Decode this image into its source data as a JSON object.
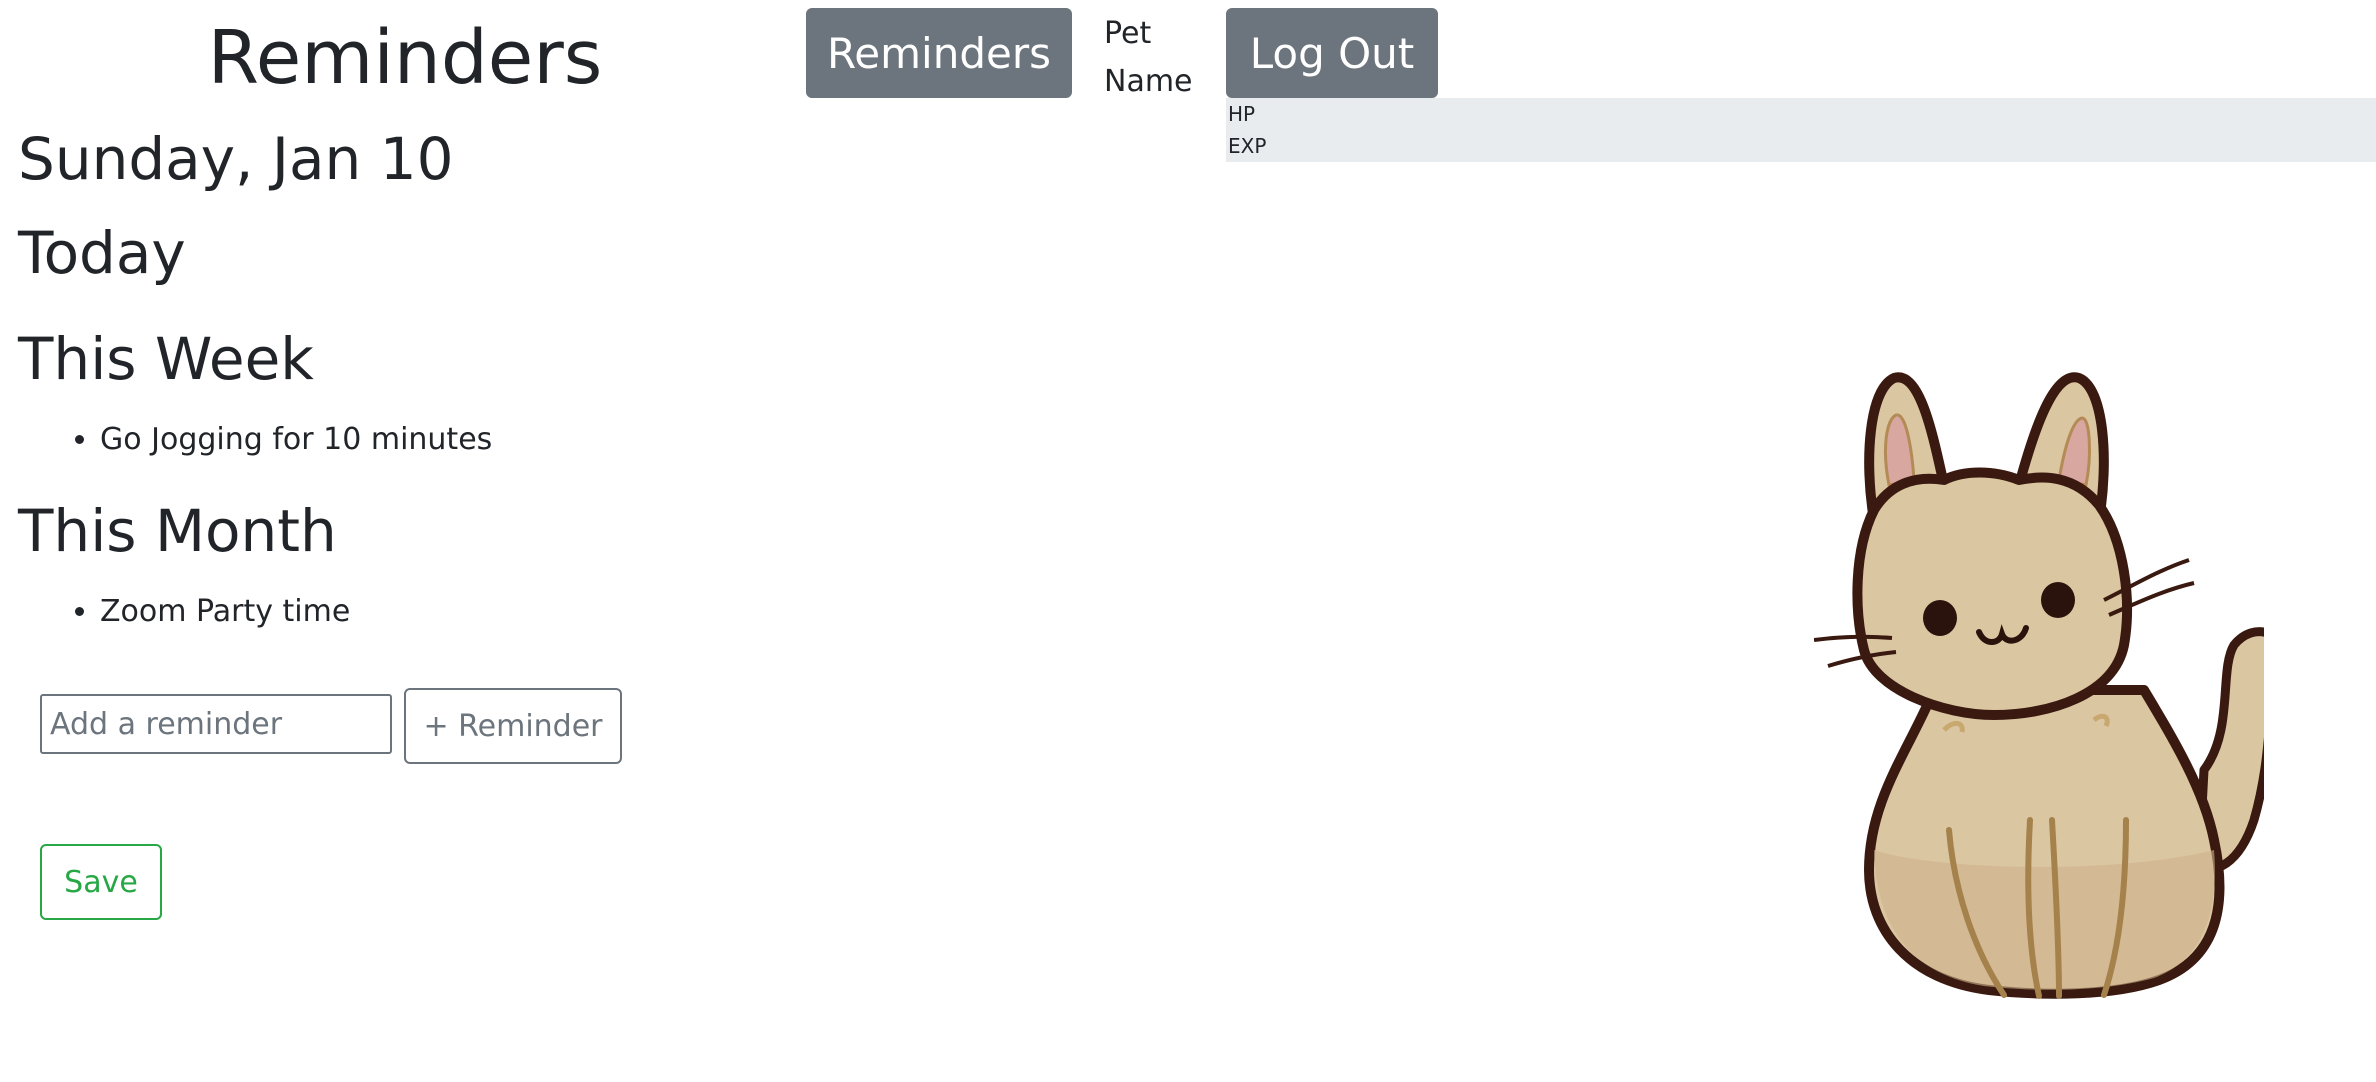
{
  "header": {
    "title": "Reminders",
    "nav_reminders_label": "Reminders",
    "pet_name": "Pet Name",
    "logout_label": "Log Out"
  },
  "stats": {
    "hp_label": "HP",
    "exp_label": "EXP"
  },
  "main": {
    "date_heading": "Sunday, Jan 10",
    "sections": [
      {
        "heading": "Today",
        "items": []
      },
      {
        "heading": "This Week",
        "items": [
          "Go Jogging for 10 minutes"
        ]
      },
      {
        "heading": "This Month",
        "items": [
          "Zoom Party time"
        ]
      }
    ]
  },
  "form": {
    "input_value": "",
    "input_placeholder": "Add a reminder",
    "add_button_label": "+ Reminder",
    "save_button_label": "Save"
  },
  "pet": {
    "icon": "cat-icon"
  },
  "colors": {
    "nav_button_bg": "#6c757d",
    "stats_bar_bg": "#e9ecef",
    "save_accent": "#28a745",
    "text": "#212529",
    "cat_fur": "#dbc6a2",
    "cat_outline": "#3a1a10"
  }
}
